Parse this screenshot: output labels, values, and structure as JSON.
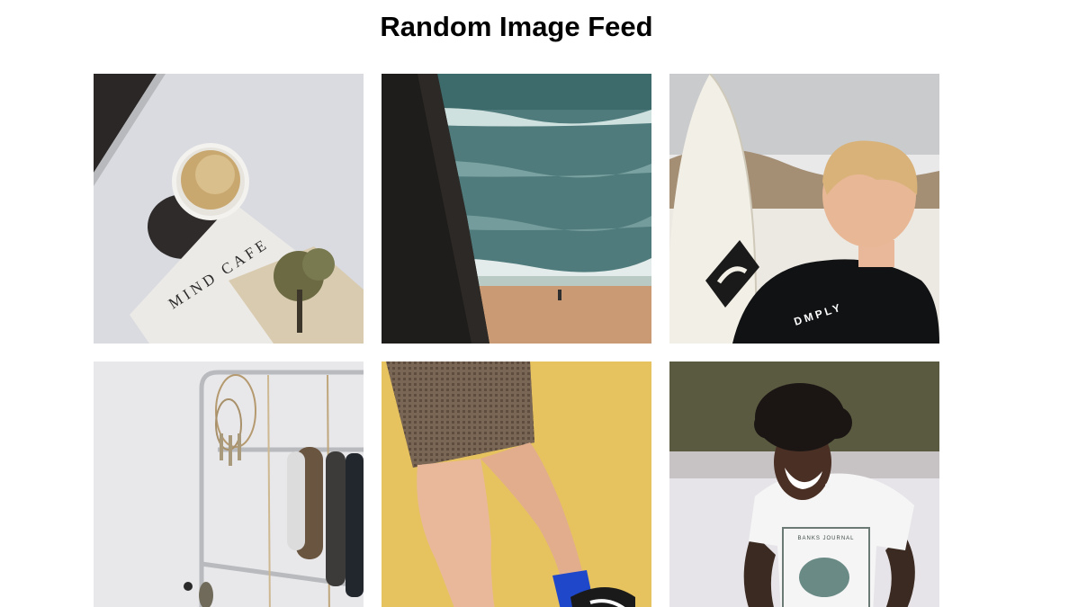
{
  "page": {
    "title": "Random Image Feed"
  },
  "feed": {
    "items": [
      {
        "subject": "coffee cup on magazine",
        "magazine_text": "MIND CAFE"
      },
      {
        "subject": "ocean waves beside tree trunk"
      },
      {
        "subject": "surfer holding surfboard on beach",
        "wetsuit_text": "DMPLY"
      },
      {
        "subject": "jewelry on metal stand"
      },
      {
        "subject": "legs in skirt on yellow background"
      },
      {
        "subject": "laughing woman in white t-shirt",
        "shirt_text": "BANKS JOURNAL"
      }
    ]
  },
  "colors": {
    "background": "#ffffff",
    "title": "#000000"
  }
}
